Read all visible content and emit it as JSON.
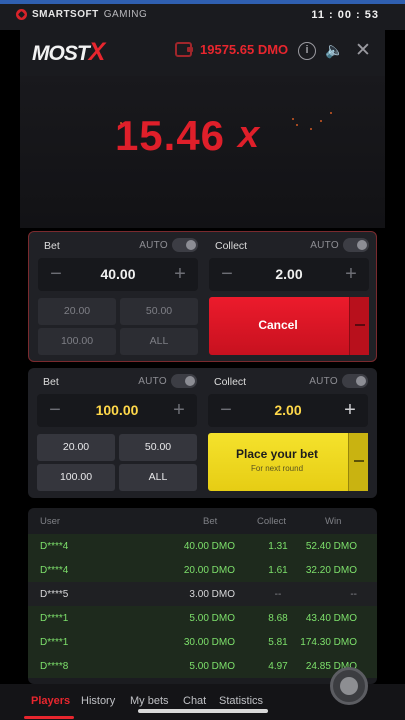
{
  "system": {
    "brand_strong": "SMARTSOFT",
    "brand_light": "GAMING",
    "time": "11 : 00 : 53"
  },
  "header": {
    "logo_main": "MOST",
    "logo_x": "X",
    "balance": "19575.65 DMO",
    "icons": [
      "wallet-icon",
      "info-icon",
      "sound-icon",
      "close-icon"
    ]
  },
  "game": {
    "multiplier": "15.46",
    "multiplier_suffix": "x"
  },
  "panel1": {
    "bet": {
      "label": "Bet",
      "auto_label": "AUTO",
      "value": "40.00",
      "chips": [
        "20.00",
        "50.00",
        "100.00",
        "ALL"
      ]
    },
    "collect": {
      "label": "Collect",
      "auto_label": "AUTO",
      "value": "2.00"
    },
    "action": {
      "label": "Cancel"
    }
  },
  "panel2": {
    "bet": {
      "label": "Bet",
      "auto_label": "AUTO",
      "value": "100.00",
      "chips": [
        "20.00",
        "50.00",
        "100.00",
        "ALL"
      ]
    },
    "collect": {
      "label": "Collect",
      "auto_label": "AUTO",
      "value": "2.00"
    },
    "action": {
      "label": "Place your bet",
      "sub_label": "For next round"
    }
  },
  "table": {
    "headers": {
      "user": "User",
      "bet": "Bet",
      "collect": "Collect",
      "win": "Win"
    },
    "rows": [
      {
        "user": "D****4",
        "bet": "40.00  DMO",
        "collect": "1.31",
        "win": "52.40  DMO",
        "status": "win"
      },
      {
        "user": "D****4",
        "bet": "20.00  DMO",
        "collect": "1.61",
        "win": "32.20  DMO",
        "status": "win"
      },
      {
        "user": "D****5",
        "bet": "3.00  DMO",
        "collect": "--",
        "win": "--",
        "status": "lose"
      },
      {
        "user": "D****1",
        "bet": "5.00  DMO",
        "collect": "8.68",
        "win": "43.40  DMO",
        "status": "win"
      },
      {
        "user": "D****1",
        "bet": "30.00  DMO",
        "collect": "5.81",
        "win": "174.30  DMO",
        "status": "win"
      },
      {
        "user": "D****8",
        "bet": "5.00  DMO",
        "collect": "4.97",
        "win": "24.85  DMO",
        "status": "win"
      }
    ]
  },
  "tabs": [
    "Players",
    "History",
    "My bets",
    "Chat",
    "Statistics"
  ],
  "colors": {
    "accent": "#e8262e",
    "win_green": "#7de06b",
    "place_yellow": "#f5e22c"
  }
}
